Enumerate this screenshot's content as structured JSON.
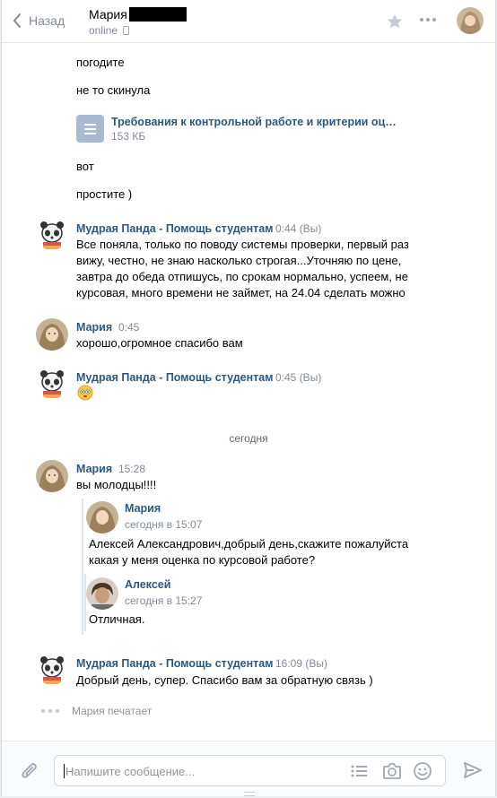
{
  "header": {
    "back_label": "Назад",
    "peer_name": "Мария",
    "peer_status": "online"
  },
  "messages": {
    "m1": "погодите",
    "m2": "не то скинула",
    "doc_title": "Требования к контрольной работе и критерии оцен...",
    "doc_size": "153 КБ",
    "m3": "вот",
    "m4": "простите )",
    "g1_author": "Мудрая Панда - Помощь студентам",
    "g1_time": "0:44 (Вы)",
    "g1_line1": "Все поняла, только по поводу системы проверки, первый раз",
    "g1_line2": "вижу, честно, не знаю насколько строгая...Уточняю по цене,",
    "g1_line3": "завтра до обеда отпишусь, по срокам нормально, успеем, не",
    "g1_line4": "курсовая, много времени не займет, на 24.04 сделать можно",
    "g2_author": "Мария",
    "g2_time": "0:45",
    "g2_text": "хорошо,огромное спасибо вам",
    "g3_author": "Мудрая Панда - Помощь студентам",
    "g3_time": "0:45 (Вы)",
    "date_separator": "сегодня",
    "g4_author": "Мария",
    "g4_time": "15:28",
    "g4_text": "вы молодцы!!!!",
    "fwd1_name": "Мария",
    "fwd1_time": "сегодня в 15:07",
    "fwd1_line1": "Алексей Александрович,добрый день,скажите пожалуйста",
    "fwd1_line2": "какая у меня оценка по курсовой работе?",
    "fwd2_name": "Алексей",
    "fwd2_time": "сегодня в 15:27",
    "fwd2_text": "Отличная.",
    "g5_author": "Мудрая Панда - Помощь студентам",
    "g5_time": "16:09 (Вы)",
    "g5_text": "Добрый день, супер. Спасибо вам за обратную связь )",
    "typing": "Мария печатает"
  },
  "composer": {
    "placeholder": "Напишите сообщение..."
  },
  "colors": {
    "link": "#2a5885",
    "muted": "#828a99",
    "doc_icon": "#a7bad1"
  }
}
